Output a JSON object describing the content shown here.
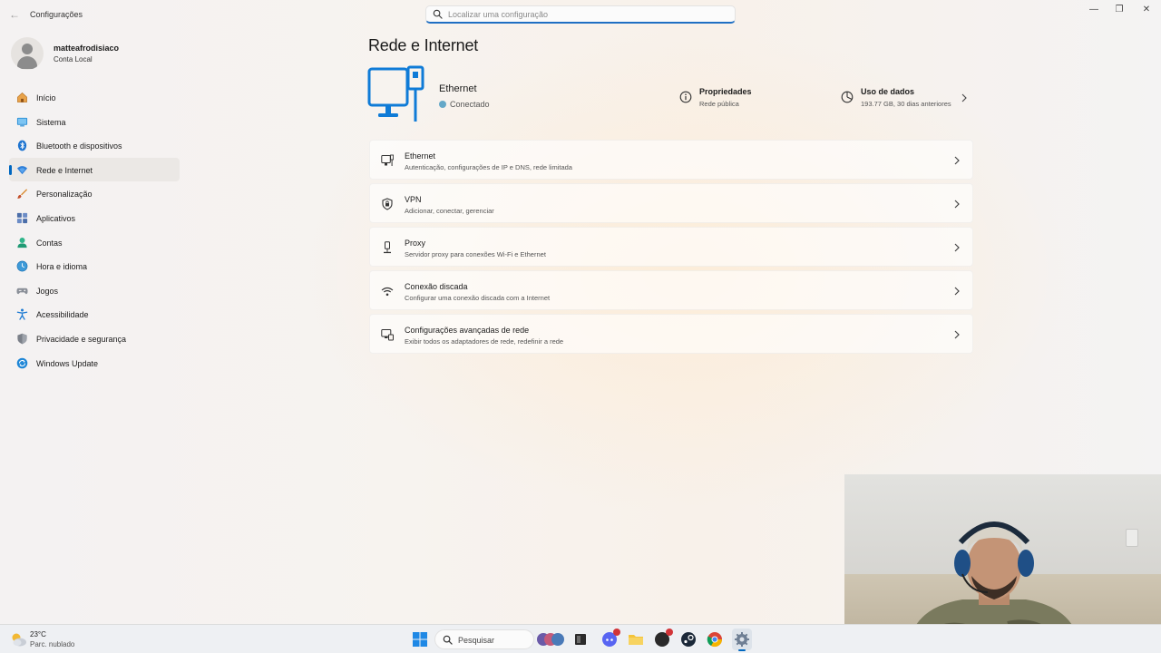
{
  "window": {
    "title": "Configurações",
    "search_placeholder": "Localizar uma configuração"
  },
  "profile": {
    "name": "matteafrodisiaco",
    "account_type": "Conta Local"
  },
  "sidebar": {
    "items": [
      {
        "label": "Início",
        "icon": "home-icon"
      },
      {
        "label": "Sistema",
        "icon": "system-icon"
      },
      {
        "label": "Bluetooth e dispositivos",
        "icon": "bluetooth-icon"
      },
      {
        "label": "Rede e Internet",
        "icon": "wifi-icon",
        "active": true
      },
      {
        "label": "Personalização",
        "icon": "brush-icon"
      },
      {
        "label": "Aplicativos",
        "icon": "apps-icon"
      },
      {
        "label": "Contas",
        "icon": "account-icon"
      },
      {
        "label": "Hora e idioma",
        "icon": "globe-clock-icon"
      },
      {
        "label": "Jogos",
        "icon": "gamepad-icon"
      },
      {
        "label": "Acessibilidade",
        "icon": "accessibility-icon"
      },
      {
        "label": "Privacidade e segurança",
        "icon": "shield-icon"
      },
      {
        "label": "Windows Update",
        "icon": "update-icon"
      }
    ]
  },
  "main": {
    "title": "Rede e Internet",
    "connection": {
      "name": "Ethernet",
      "status": "Conectado"
    },
    "properties": {
      "title": "Propriedades",
      "subtitle": "Rede pública"
    },
    "data_usage": {
      "title": "Uso de dados",
      "subtitle": "193.77 GB, 30 dias anteriores"
    },
    "cards": [
      {
        "title": "Ethernet",
        "subtitle": "Autenticação, configurações de IP e DNS, rede limitada",
        "icon": "ethernet-icon"
      },
      {
        "title": "VPN",
        "subtitle": "Adicionar, conectar, gerenciar",
        "icon": "vpn-shield-icon"
      },
      {
        "title": "Proxy",
        "subtitle": "Servidor proxy para conexões Wi-Fi e Ethernet",
        "icon": "proxy-icon"
      },
      {
        "title": "Conexão discada",
        "subtitle": "Configurar uma conexão discada com a Internet",
        "icon": "dialup-icon"
      },
      {
        "title": "Configurações avançadas de rede",
        "subtitle": "Exibir todos os adaptadores de rede, redefinir a rede",
        "icon": "advanced-network-icon"
      }
    ]
  },
  "taskbar": {
    "weather_temp": "23°C",
    "weather_desc": "Parc. nublado",
    "search_label": "Pesquisar"
  },
  "colors": {
    "accent": "#0067c0",
    "status_connected": "#64a8c8"
  }
}
